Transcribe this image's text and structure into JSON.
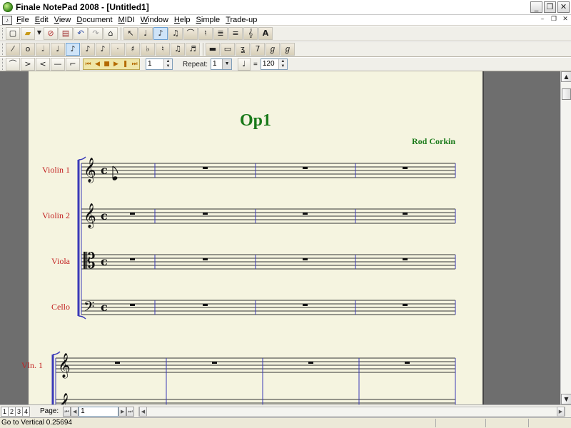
{
  "window": {
    "title": "Finale NotePad 2008 - [Untitled1]",
    "controls": {
      "minimize": "_",
      "maximize": "❐",
      "close": "✕"
    }
  },
  "menu": {
    "items": [
      "File",
      "Edit",
      "View",
      "Document",
      "MIDI",
      "Window",
      "Help",
      "Simple",
      "Trade-up"
    ],
    "mdi_controls": [
      "–",
      "❐",
      "✕"
    ]
  },
  "toolbars": {
    "row1": [
      "new-icon",
      "open-icon",
      "dropdown-icon",
      "save-icon",
      "print-icon",
      "undo-icon",
      "redo-icon",
      "selection-icon",
      "staff-icon",
      "measure-icon",
      "simple-entry-icon",
      "speedy-entry-icon",
      "smart-shape-icon",
      "articulation-icon",
      "text-icon",
      "lyrics-icon",
      "chord-icon",
      "font-icon"
    ],
    "row2": [
      "eraser-icon",
      "whole-note-icon",
      "half-note-icon",
      "quarter-note-icon",
      "eighth-note-icon",
      "sixteenth-note-icon",
      "thirtysecond-note-icon",
      "dot-icon",
      "sharp-icon",
      "flat-icon",
      "natural-icon",
      "tie-icon",
      "tuplet-icon",
      "whole-rest-icon",
      "half-rest-icon",
      "quarter-rest-icon",
      "eighth-rest-icon",
      "sixteenth-rest-icon"
    ],
    "row3": {
      "icons": [
        "slur-icon",
        "crescendo-icon",
        "decrescendo-icon",
        "line-icon",
        "bend-icon"
      ],
      "playback_icons": [
        "rewind-start-icon",
        "rewind-icon",
        "stop-icon",
        "play-icon",
        "pause-icon",
        "forward-icon"
      ],
      "measure_value": "1",
      "repeat_label": "Repeat:",
      "repeat_value": "1",
      "tempo_equals": "=",
      "tempo_value": "120"
    }
  },
  "score": {
    "title": "Op1",
    "composer": "Rod Corkin",
    "instruments": [
      "Violin 1",
      "Violin 2",
      "Viola",
      "Cello"
    ],
    "second_system_instrument": "Vln. 1",
    "time_signature": "𝄴",
    "clefs": [
      "treble-clef",
      "treble-clef",
      "alto-clef",
      "bass-clef"
    ]
  },
  "pagebar": {
    "page_tabs": [
      "1",
      "2",
      "3",
      "4"
    ],
    "page_label": "Page:",
    "page_value": "1"
  },
  "status": {
    "text": "Go to Vertical 0.25694"
  },
  "colors": {
    "title": "#1a7a1a",
    "instrument": "#c22020",
    "barline": "#3a3ab8",
    "paper": "#f5f4e0"
  }
}
